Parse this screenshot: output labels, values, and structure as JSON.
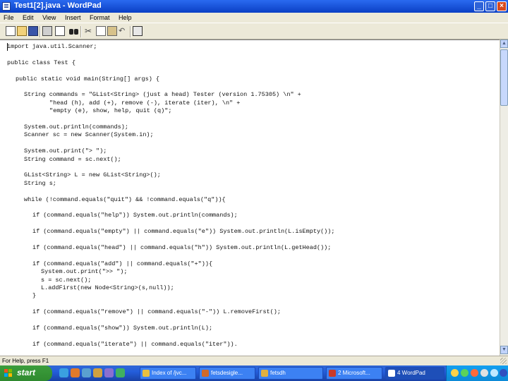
{
  "window": {
    "title": "Test1[2].java - WordPad"
  },
  "menu": [
    "File",
    "Edit",
    "View",
    "Insert",
    "Format",
    "Help"
  ],
  "toolbar_icons": [
    "new-document-icon",
    "open-folder-icon",
    "save-disk-icon",
    "print-icon",
    "print-preview-icon",
    "find-binoculars-icon",
    "cut-scissors-icon",
    "copy-icon",
    "paste-icon",
    "undo-icon",
    "insert-object-icon"
  ],
  "document": {
    "lines": [
      {
        "indent": 0,
        "text": "import java.util.Scanner;"
      },
      {
        "indent": 0,
        "text": ""
      },
      {
        "indent": 0,
        "text": "public class Test {"
      },
      {
        "indent": 0,
        "text": ""
      },
      {
        "indent": 1,
        "text": "public static void main(String[] args) {"
      },
      {
        "indent": 0,
        "text": ""
      },
      {
        "indent": 2,
        "text": "String commands = \"GList<String> (just a head) Tester (version 1.75305) \\n\" +"
      },
      {
        "indent": 5,
        "text": "\"head (h), add (+), remove (-), iterate (iter), \\n\" +"
      },
      {
        "indent": 5,
        "text": "\"empty (e), show, help, quit (q)\";"
      },
      {
        "indent": 0,
        "text": ""
      },
      {
        "indent": 2,
        "text": "System.out.println(commands);"
      },
      {
        "indent": 2,
        "text": "Scanner sc = new Scanner(System.in);"
      },
      {
        "indent": 0,
        "text": ""
      },
      {
        "indent": 2,
        "text": "System.out.print(\"> \");"
      },
      {
        "indent": 2,
        "text": "String command = sc.next();"
      },
      {
        "indent": 0,
        "text": ""
      },
      {
        "indent": 2,
        "text": "GList<String> L = new GList<String>();"
      },
      {
        "indent": 2,
        "text": "String s;"
      },
      {
        "indent": 0,
        "text": ""
      },
      {
        "indent": 2,
        "text": "while (!command.equals(\"quit\") && !command.equals(\"q\")){"
      },
      {
        "indent": 0,
        "text": ""
      },
      {
        "indent": 3,
        "text": "if (command.equals(\"help\")) System.out.println(commands);"
      },
      {
        "indent": 0,
        "text": ""
      },
      {
        "indent": 3,
        "text": "if (command.equals(\"empty\") || command.equals(\"e\")) System.out.println(L.isEmpty());"
      },
      {
        "indent": 0,
        "text": ""
      },
      {
        "indent": 3,
        "text": "if (command.equals(\"head\") || command.equals(\"h\")) System.out.println(L.getHead());"
      },
      {
        "indent": 0,
        "text": ""
      },
      {
        "indent": 3,
        "text": "if (command.equals(\"add\") || command.equals(\"+\")){"
      },
      {
        "indent": 4,
        "text": "System.out.print(\">> \");"
      },
      {
        "indent": 4,
        "text": "s = sc.next();"
      },
      {
        "indent": 4,
        "text": "L.addFirst(new Node<String>(s,null));"
      },
      {
        "indent": 3,
        "text": "}"
      },
      {
        "indent": 0,
        "text": ""
      },
      {
        "indent": 3,
        "text": "if (command.equals(\"remove\") || command.equals(\"-\")) L.removeFirst();"
      },
      {
        "indent": 0,
        "text": ""
      },
      {
        "indent": 3,
        "text": "if (command.equals(\"show\")) System.out.println(L);"
      },
      {
        "indent": 0,
        "text": ""
      },
      {
        "indent": 3,
        "text": "if (command.equals(\"iterate\") || command.equals(\"iter\"))."
      }
    ]
  },
  "status": {
    "text": "For Help, press F1"
  },
  "taskbar": {
    "start_label": "start",
    "tasks": [
      {
        "label": "Index of /jvc...",
        "active": false,
        "color": "#e8c040"
      },
      {
        "label": "fetsdesigle...",
        "active": false,
        "color": "#d06a2a"
      },
      {
        "label": "fetsdh",
        "active": false,
        "color": "#e0b040"
      },
      {
        "label": "2 Microsoft...",
        "active": false,
        "color": "#c83a2a"
      },
      {
        "label": "4 WordPad",
        "active": true,
        "color": "#ffffff"
      }
    ]
  }
}
